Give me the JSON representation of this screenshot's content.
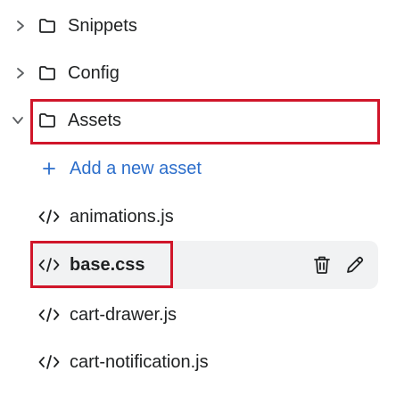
{
  "colors": {
    "text": "#202223",
    "accent": "#2c6ecb",
    "highlight": "#d0162a",
    "selected_bg": "#f1f2f3"
  },
  "tree": {
    "folders": [
      {
        "label": "Snippets",
        "icon": "folder-icon",
        "expanded": false
      },
      {
        "label": "Config",
        "icon": "folder-icon",
        "expanded": false
      },
      {
        "label": "Assets",
        "icon": "folder-icon",
        "expanded": true
      }
    ],
    "add_asset_label": "Add a new asset",
    "files": [
      {
        "label": "animations.js",
        "icon": "code-icon"
      },
      {
        "label": "base.css",
        "icon": "code-icon",
        "selected": true
      },
      {
        "label": "cart-drawer.js",
        "icon": "code-icon"
      },
      {
        "label": "cart-notification.js",
        "icon": "code-icon"
      }
    ]
  }
}
